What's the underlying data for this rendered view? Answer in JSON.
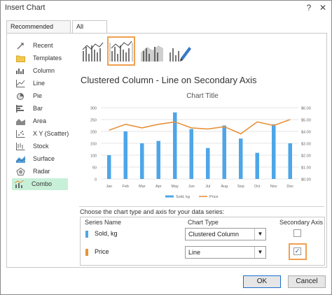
{
  "window": {
    "title": "Insert Chart",
    "help": "?",
    "close": "✕"
  },
  "tabs": [
    {
      "label": "Recommended Charts",
      "active": false
    },
    {
      "label": "All Charts",
      "active": true
    }
  ],
  "sidebar": {
    "items": [
      {
        "label": "Recent",
        "icon": "recent-icon"
      },
      {
        "label": "Templates",
        "icon": "folder-icon"
      },
      {
        "label": "Column",
        "icon": "column-chart-icon"
      },
      {
        "label": "Line",
        "icon": "line-chart-icon"
      },
      {
        "label": "Pie",
        "icon": "pie-chart-icon"
      },
      {
        "label": "Bar",
        "icon": "bar-chart-icon"
      },
      {
        "label": "Area",
        "icon": "area-chart-icon"
      },
      {
        "label": "X Y (Scatter)",
        "icon": "scatter-chart-icon"
      },
      {
        "label": "Stock",
        "icon": "stock-chart-icon"
      },
      {
        "label": "Surface",
        "icon": "surface-chart-icon"
      },
      {
        "label": "Radar",
        "icon": "radar-chart-icon"
      },
      {
        "label": "Combo",
        "icon": "combo-chart-icon",
        "selected": true
      }
    ]
  },
  "subtypes": [
    {
      "icon": "clustered-column-line-icon"
    },
    {
      "icon": "clustered-column-line-secondary-icon",
      "selected": true
    },
    {
      "icon": "stacked-area-clustered-column-icon"
    },
    {
      "icon": "custom-combination-icon"
    }
  ],
  "subtype_title": "Clustered Column - Line on Secondary Axis",
  "chart_data": {
    "type": "bar",
    "title": "Chart Title",
    "categories": [
      "Jan",
      "Feb",
      "Mar",
      "Apr",
      "May",
      "Jun",
      "Jul",
      "Aug",
      "Sep",
      "Oct",
      "Nov",
      "Dec"
    ],
    "series": [
      {
        "name": "Sold, kg",
        "type": "bar",
        "axis": "primary",
        "values": [
          100,
          200,
          150,
          160,
          280,
          210,
          130,
          225,
          170,
          110,
          230,
          150
        ]
      },
      {
        "name": "Price",
        "type": "line",
        "axis": "secondary",
        "values": [
          4.1,
          4.6,
          4.3,
          4.6,
          4.8,
          4.3,
          4.2,
          4.4,
          3.8,
          4.8,
          4.5,
          5.0
        ]
      }
    ],
    "ylim": [
      0,
      300
    ],
    "yticks": [
      "0",
      "50",
      "100",
      "150",
      "200",
      "250",
      "300"
    ],
    "y2lim": [
      0,
      6
    ],
    "y2ticks": [
      "$0.00",
      "$1.00",
      "$2.00",
      "$3.00",
      "$4.00",
      "$5.00",
      "$6.00"
    ],
    "legend": "bottom",
    "colors": {
      "bar": "#4ea6e8",
      "line": "#e8923a"
    }
  },
  "series_config": {
    "prompt": "Choose the chart type and axis for your data series:",
    "headers": {
      "name": "Series Name",
      "type": "Chart Type",
      "axis": "Secondary Axis"
    },
    "rows": [
      {
        "name": "Sold, kg",
        "color": "#4ea6e8",
        "chart_type": "Clustered Column",
        "secondary": false
      },
      {
        "name": "Price",
        "color": "#e8923a",
        "chart_type": "Line",
        "secondary": true
      }
    ]
  },
  "buttons": {
    "ok": "OK",
    "cancel": "Cancel"
  }
}
